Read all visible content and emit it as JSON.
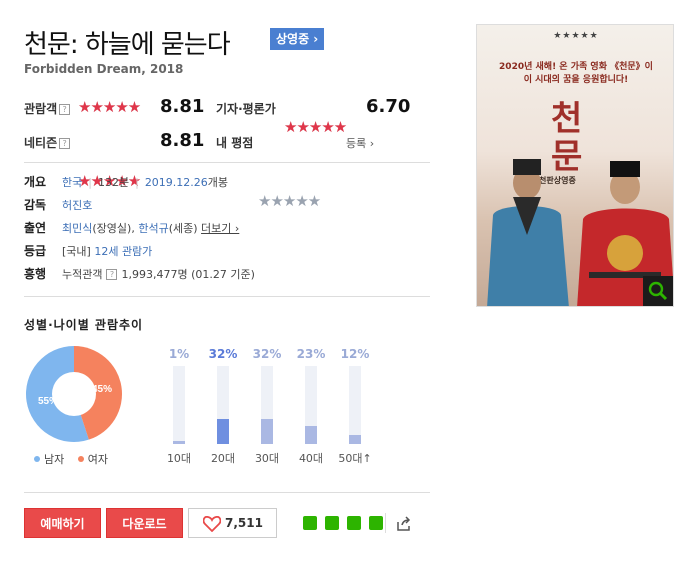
{
  "movie": {
    "title": "천문: 하늘에 묻는다",
    "status_badge": "상영중 ›",
    "subtitle": "Forbidden Dream, 2018"
  },
  "ratings": {
    "audience": {
      "label": "관람객",
      "help": "?",
      "score": "8.81",
      "fraction": 0.881
    },
    "critic": {
      "label": "기자·평론가",
      "score": "6.70",
      "fraction": 0.67
    },
    "netizen": {
      "label": "네티즌",
      "help": "?",
      "score": "8.81",
      "fraction": 0.881
    },
    "mine": {
      "label": "내 평점",
      "register": "등록 ›",
      "fraction": 0
    }
  },
  "info": {
    "overview": {
      "label": "개요",
      "country": "한국",
      "runtime": "132분",
      "release": "2019.12.26",
      "release_suffix": "개봉"
    },
    "director": {
      "label": "감독",
      "name": "허진호"
    },
    "cast": {
      "label": "출연",
      "actor1": "최민식",
      "role1": "(장영실)",
      "comma": ", ",
      "actor2": "한석규",
      "role2": "(세종)",
      "more": "더보기 ›"
    },
    "grade": {
      "label": "등급",
      "region": "[국내]",
      "rating": "12세 관람가"
    },
    "boxoffice": {
      "label": "흥행",
      "caption": "누적관객",
      "help": "?",
      "value": "1,993,477명",
      "date": "(01.27 기준)"
    }
  },
  "demographics": {
    "title": "성별·나이별 관람추이",
    "gender": {
      "male_label": "남자",
      "female_label": "여자",
      "male_pct": "55%",
      "female_pct": "45%",
      "male_fraction": 0.55,
      "female_fraction": 0.45,
      "male_color": "#7fb6ee",
      "female_color": "#f5825e"
    },
    "ages": [
      {
        "label": "10대",
        "pct": "1%",
        "value": 1,
        "highlight": false
      },
      {
        "label": "20대",
        "pct": "32%",
        "value": 32,
        "highlight": true
      },
      {
        "label": "30대",
        "pct": "32%",
        "value": 32,
        "highlight": false
      },
      {
        "label": "40대",
        "pct": "23%",
        "value": 23,
        "highlight": false
      },
      {
        "label": "50대↑",
        "pct": "12%",
        "value": 12,
        "highlight": false
      }
    ]
  },
  "actions": {
    "reserve": "예매하기",
    "download": "다운로드",
    "likes": "7,511"
  },
  "poster": {
    "stars": "★★★★★",
    "tagline1": "2020년 새해! 온 가족 영화 《천문》이",
    "tagline2": "이 시대의 꿈을 응원합니다!",
    "title_glyph1": "천",
    "title_glyph2": "문",
    "subtitle": "천판상영중"
  },
  "colors": {
    "accent_red": "#e94a4a",
    "link_blue": "#3d6fb6",
    "badge_blue": "#4a7fd1"
  }
}
